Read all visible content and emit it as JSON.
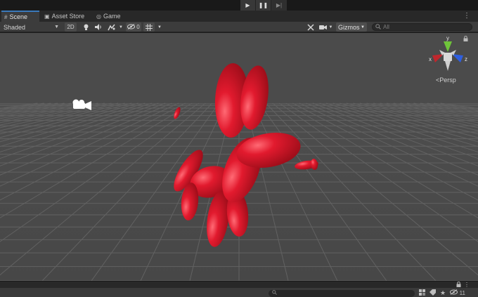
{
  "playbar": {
    "play_icon": "▶",
    "pause_icon": "❚❚",
    "step_icon": "▶|"
  },
  "tabs": [
    {
      "label": "Scene",
      "icon": "#",
      "icon_name": "scene-grid-icon",
      "active": true
    },
    {
      "label": "Asset Store",
      "icon": "▣",
      "icon_name": "asset-store-icon",
      "active": false
    },
    {
      "label": "Game",
      "icon": "◎",
      "icon_name": "game-controller-icon",
      "active": false
    }
  ],
  "tab_menu_icon": "⋮",
  "scene_toolbar": {
    "draw_mode": "Shaded",
    "mode_2d": "2D",
    "hidden_count": "0",
    "gizmos_label": "Gizmos",
    "search_placeholder": "All"
  },
  "scene_gizmo": {
    "axis_y": "y",
    "axis_x": "x",
    "axis_z": "z",
    "projection": "Persp",
    "colors": {
      "x": "#c0272d",
      "y": "#6fc43a",
      "z": "#2f5fe0",
      "neutral": "#cfcfcf"
    }
  },
  "viewport": {
    "background": "#474747",
    "sky": "#4a4a4a",
    "grid_color": "#6a6a6a",
    "balloon_color": "#e0192c"
  },
  "bottom": {
    "visible_count": "11",
    "lock_icon": "🔒",
    "menu_icon": "⋮"
  }
}
